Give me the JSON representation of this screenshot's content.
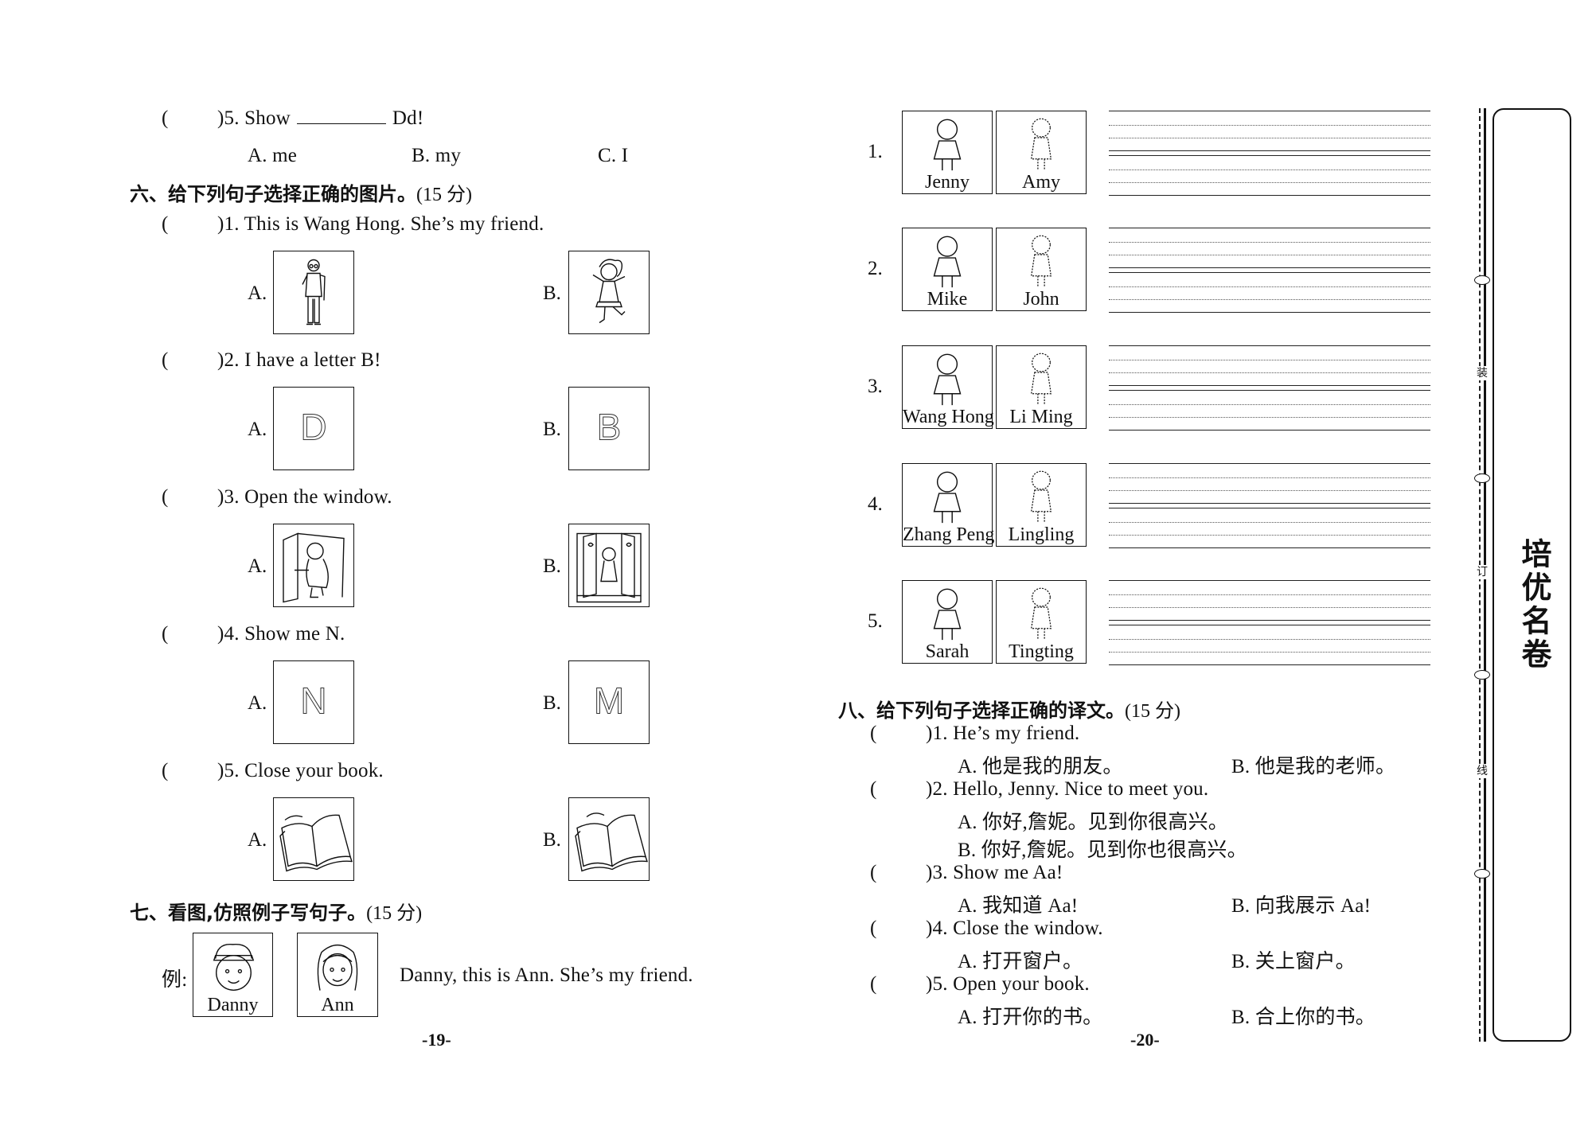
{
  "left_page": {
    "prev_question": {
      "paren": "(",
      "close": ")",
      "number": "5.",
      "text_before": "Show",
      "text_after": "Dd!",
      "options": [
        "A. me",
        "B. my",
        "C. I"
      ]
    },
    "section6": {
      "title": "六、给下列句子选择正确的图片。",
      "points": "(15 分)",
      "questions": [
        {
          "prompt": ")1. This is Wang Hong.  She’s my friend.",
          "option_a": "A.",
          "option_b": "B.",
          "image_a": "teacher-man-icon",
          "image_b": "girl-icon"
        },
        {
          "prompt": ")2. I have a letter B!",
          "option_a": "A.",
          "option_b": "B.",
          "image_a": "letter-d-icon",
          "image_b": "letter-b-icon",
          "letter_a": "D",
          "letter_b": "B"
        },
        {
          "prompt": ")3. Open the window.",
          "option_a": "A.",
          "option_b": "B.",
          "image_a": "open-door-icon",
          "image_b": "open-window-icon"
        },
        {
          "prompt": ")4. Show me N.",
          "option_a": "A.",
          "option_b": "B.",
          "image_a": "letter-n-icon",
          "image_b": "letter-m-icon",
          "letter_a": "N",
          "letter_b": "M"
        },
        {
          "prompt": ")5. Close your book.",
          "option_a": "A.",
          "option_b": "B.",
          "image_a": "open-book-icon",
          "image_b": "open-book-icon"
        }
      ]
    },
    "section7": {
      "title": "七、看图,仿照例子写句子。",
      "points": "(15 分)",
      "example_label": "例:",
      "example_names": [
        "Danny",
        "Ann"
      ],
      "example_sentence": "Danny, this is Ann.  She’s my friend."
    },
    "page_number": "-19-"
  },
  "right_page": {
    "pairs": [
      {
        "num": "1.",
        "names": [
          "Jenny",
          "Amy"
        ]
      },
      {
        "num": "2.",
        "names": [
          "Mike",
          "John"
        ]
      },
      {
        "num": "3.",
        "names": [
          "Wang Hong",
          "Li Ming"
        ]
      },
      {
        "num": "4.",
        "names": [
          "Zhang Peng",
          "Lingling"
        ]
      },
      {
        "num": "5.",
        "names": [
          "Sarah",
          "Tingting"
        ]
      }
    ],
    "section8": {
      "title": "八、给下列句子选择正确的译文。",
      "points": "(15 分)",
      "questions": [
        {
          "prompt": ")1. He’s my friend.",
          "a": "A. 他是我的朋友。",
          "b": "B. 他是我的老师。"
        },
        {
          "prompt": ")2. Hello, Jenny.  Nice to meet you.",
          "a": "A. 你好,詹妮。见到你很高兴。",
          "b": "B. 你好,詹妮。见到你也很高兴。"
        },
        {
          "prompt": ")3. Show me Aa!",
          "a": "A. 我知道 Aa!",
          "b": "B. 向我展示 Aa!"
        },
        {
          "prompt": ")4. Close the window.",
          "a": "A. 打开窗户。",
          "b": "B. 关上窗户。"
        },
        {
          "prompt": ")5. Open your book.",
          "a": "A. 打开你的书。",
          "b": "B. 合上你的书。"
        }
      ]
    },
    "page_number": "-20-"
  },
  "binding_strip": {
    "labels": [
      "装",
      "订",
      "线"
    ],
    "logo": "培优名卷"
  }
}
